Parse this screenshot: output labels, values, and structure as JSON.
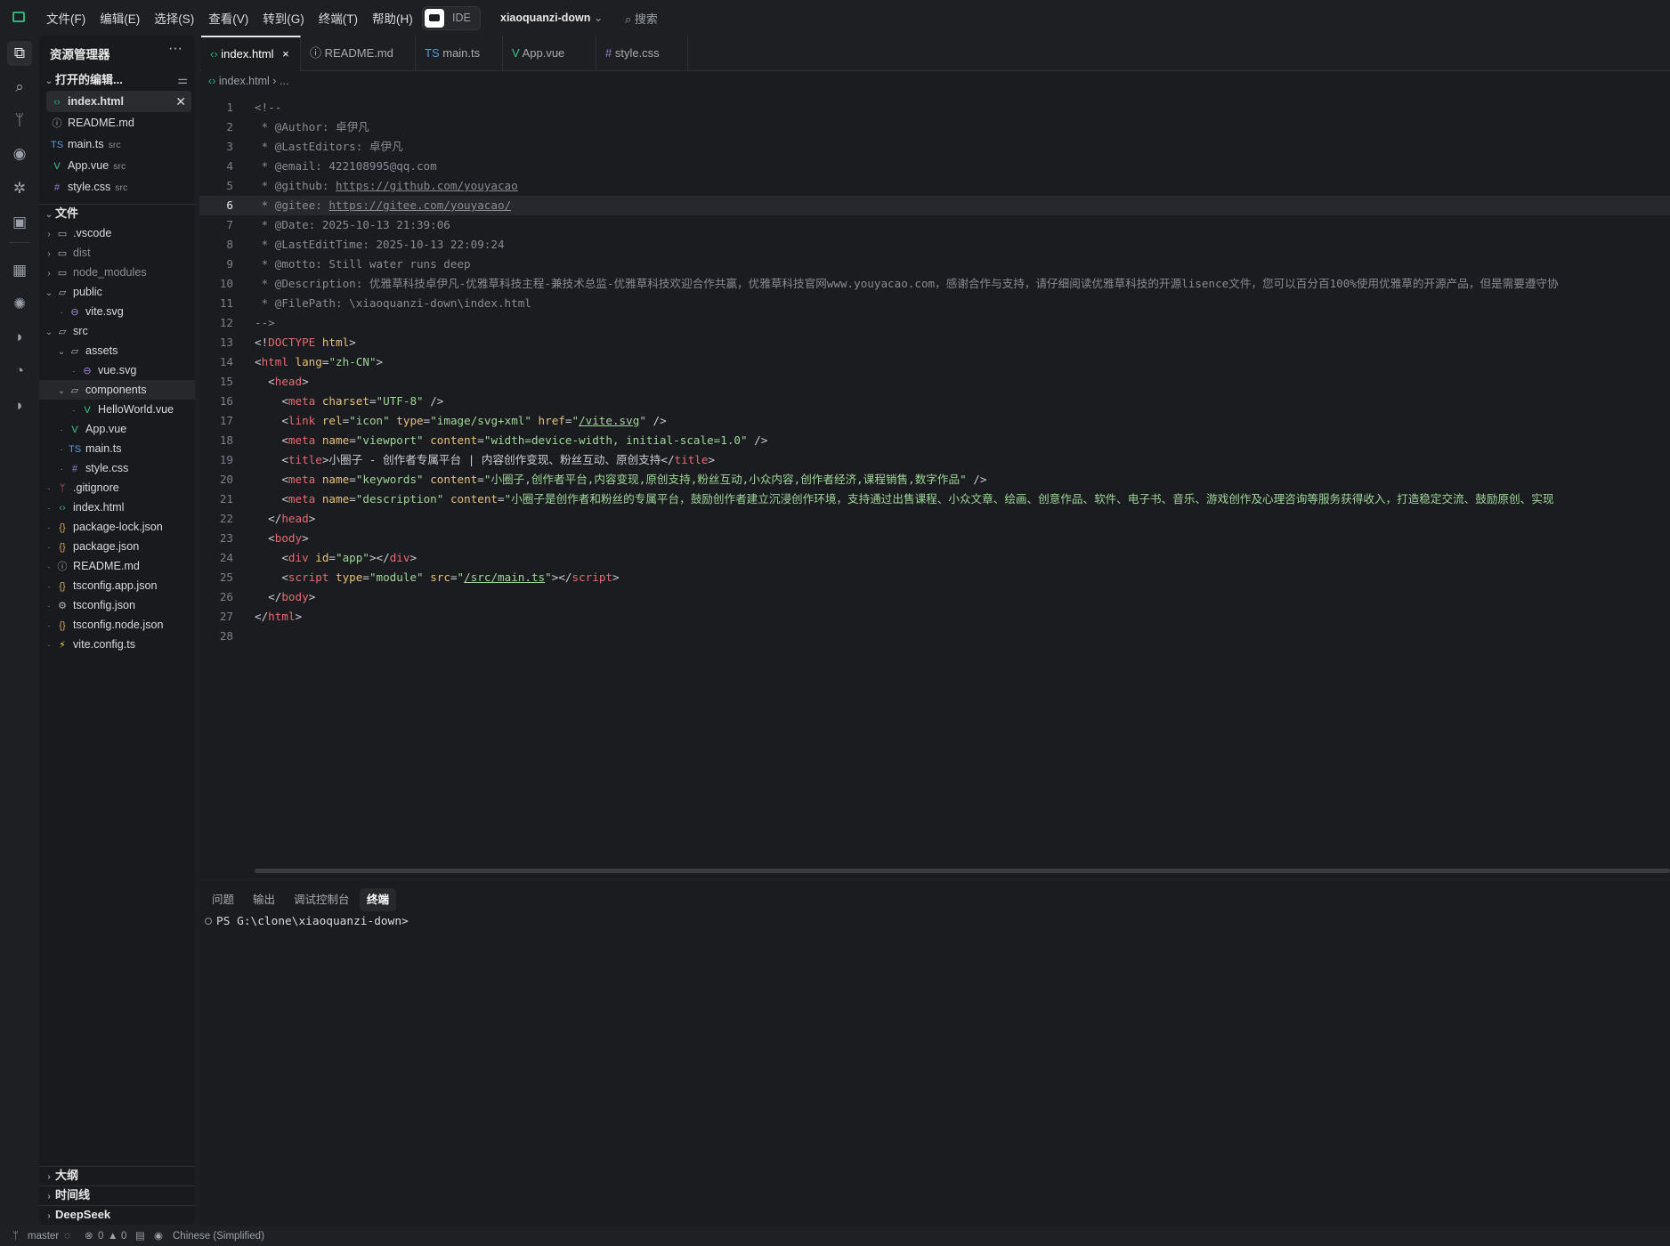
{
  "titlebar": {
    "menus": [
      "文件(F)",
      "编辑(E)",
      "选择(S)",
      "查看(V)",
      "转到(G)",
      "终端(T)",
      "帮助(H)"
    ],
    "ide_label": "IDE",
    "project": "xiaoquanzi-down",
    "search": "搜索"
  },
  "activity": [
    "files-icon",
    "search-icon",
    "source-control-icon",
    "eye-icon",
    "debug-icon",
    "remote-icon",
    "extensions-icon",
    "ai-icon",
    "deepseek-icon",
    "whale-icon",
    "deepseek-alt-icon"
  ],
  "sidebar": {
    "title": "资源管理器",
    "more": "···",
    "open_editors": {
      "label": "打开的编辑...",
      "items": [
        {
          "name": "index.html",
          "icon": "‹›",
          "color": "#2fb37a",
          "dir": "",
          "selected": true
        },
        {
          "name": "README.md",
          "icon": "ⓘ",
          "color": "#b0b4ba",
          "dir": ""
        },
        {
          "name": "main.ts",
          "icon": "TS",
          "color": "#5b9bd5",
          "dir": "src"
        },
        {
          "name": "App.vue",
          "icon": "V",
          "color": "#3ec98a",
          "dir": "src"
        },
        {
          "name": "style.css",
          "icon": "#",
          "color": "#9a7fd6",
          "dir": "src"
        }
      ]
    },
    "files": {
      "label": "文件",
      "items": [
        {
          "name": ".vscode",
          "icon": "▭",
          "color": "#b0b4ba",
          "depth": 0,
          "chev": "›"
        },
        {
          "name": "dist",
          "icon": "▭",
          "color": "#b0b4ba",
          "depth": 0,
          "chev": "›",
          "muted": true
        },
        {
          "name": "node_modules",
          "icon": "▭",
          "color": "#b0b4ba",
          "depth": 0,
          "chev": "›",
          "muted": true
        },
        {
          "name": "public",
          "icon": "▱",
          "color": "#b0b4ba",
          "depth": 0,
          "chev": "⌄"
        },
        {
          "name": "vite.svg",
          "icon": "⊖",
          "color": "#a98ae8",
          "depth": 1
        },
        {
          "name": "src",
          "icon": "▱",
          "color": "#b0b4ba",
          "depth": 0,
          "chev": "⌄"
        },
        {
          "name": "assets",
          "icon": "▱",
          "color": "#b0b4ba",
          "depth": 1,
          "chev": "⌄"
        },
        {
          "name": "vue.svg",
          "icon": "⊖",
          "color": "#a98ae8",
          "depth": 2
        },
        {
          "name": "components",
          "icon": "▱",
          "color": "#b0b4ba",
          "depth": 1,
          "chev": "⌄",
          "hl": true
        },
        {
          "name": "HelloWorld.vue",
          "icon": "V",
          "color": "#3ec98a",
          "depth": 2
        },
        {
          "name": "App.vue",
          "icon": "V",
          "color": "#3ec98a",
          "depth": 1
        },
        {
          "name": "main.ts",
          "icon": "TS",
          "color": "#5b9bd5",
          "depth": 1
        },
        {
          "name": "style.css",
          "icon": "#",
          "color": "#9a7fd6",
          "depth": 1
        },
        {
          "name": ".gitignore",
          "icon": "ᛘ",
          "color": "#e0646a",
          "depth": 0
        },
        {
          "name": "index.html",
          "icon": "‹›",
          "color": "#2fb37a",
          "depth": 0
        },
        {
          "name": "package-lock.json",
          "icon": "{}",
          "color": "#d1a55a",
          "depth": 0
        },
        {
          "name": "package.json",
          "icon": "{}",
          "color": "#d1a55a",
          "depth": 0
        },
        {
          "name": "README.md",
          "icon": "ⓘ",
          "color": "#b0b4ba",
          "depth": 0
        },
        {
          "name": "tsconfig.app.json",
          "icon": "{}",
          "color": "#d1a55a",
          "depth": 0
        },
        {
          "name": "tsconfig.json",
          "icon": "⚙",
          "color": "#b0b4ba",
          "depth": 0
        },
        {
          "name": "tsconfig.node.json",
          "icon": "{}",
          "color": "#d1a55a",
          "depth": 0
        },
        {
          "name": "vite.config.ts",
          "icon": "⚡",
          "color": "#f0d33a",
          "depth": 0
        }
      ]
    },
    "bottom_sections": [
      "大纲",
      "时间线",
      "DeepSeek"
    ]
  },
  "tabs": [
    {
      "label": "index.html",
      "icon": "‹›",
      "color": "#2fb37a",
      "active": true,
      "close": "×"
    },
    {
      "label": "README.md",
      "icon": "ⓘ",
      "color": "#b0b4ba"
    },
    {
      "label": "main.ts",
      "icon": "TS",
      "color": "#5b9bd5"
    },
    {
      "label": "App.vue",
      "icon": "V",
      "color": "#3ec98a"
    },
    {
      "label": "style.css",
      "icon": "#",
      "color": "#9a7fd6"
    }
  ],
  "breadcrumb": {
    "file": "index.html",
    "rest": "..."
  },
  "current_line": 6,
  "code": [
    [
      [
        "<!--",
        "cm"
      ]
    ],
    [
      [
        " * @Author: 卓伊凡",
        "cm"
      ]
    ],
    [
      [
        " * @LastEditors: 卓伊凡",
        "cm"
      ]
    ],
    [
      [
        " * @email: 422108995@qq.com",
        "cm"
      ]
    ],
    [
      [
        " * @github: ",
        "cm"
      ],
      [
        "https://github.com/youyacao",
        "cml"
      ]
    ],
    [
      [
        " * @gitee: ",
        "cm"
      ],
      [
        "https://gitee.com/youyacao/",
        "cml"
      ]
    ],
    [
      [
        " * @Date: 2025-10-13 21:39:06",
        "cm"
      ]
    ],
    [
      [
        " * @LastEditTime: 2025-10-13 22:09:24",
        "cm"
      ]
    ],
    [
      [
        " * @motto: Still water runs deep",
        "cm"
      ]
    ],
    [
      [
        " * @Description: 优雅草科技卓伊凡-优雅草科技主程-兼技术总监-优雅草科技欢迎合作共赢，优雅草科技官网www.youyacao.com，感谢合作与支持，请仔细阅读优雅草科技的开源lisence文件，您可以百分百100%使用优雅草的开源产品，但是需要遵守协",
        "cm"
      ]
    ],
    [
      [
        " * @FilePath: \\xiaoquanzi-down\\index.html",
        "cm"
      ]
    ],
    [
      [
        "-->",
        "cm"
      ]
    ],
    [
      [
        "<!",
        "p"
      ],
      [
        "DOCTYPE",
        "tag"
      ],
      [
        " html",
        "at"
      ],
      [
        ">",
        "p"
      ]
    ],
    [
      [
        "<",
        "p"
      ],
      [
        "html",
        "tag"
      ],
      [
        " lang",
        "at"
      ],
      [
        "=",
        "p"
      ],
      [
        "\"zh-CN\"",
        "st"
      ],
      [
        ">",
        "p"
      ]
    ],
    [
      [
        "  <",
        "p"
      ],
      [
        "head",
        "tag"
      ],
      [
        ">",
        "p"
      ]
    ],
    [
      [
        "    <",
        "p"
      ],
      [
        "meta",
        "tag"
      ],
      [
        " charset",
        "at"
      ],
      [
        "=",
        "p"
      ],
      [
        "\"UTF-8\"",
        "st"
      ],
      [
        " />",
        "p"
      ]
    ],
    [
      [
        "    <",
        "p"
      ],
      [
        "link",
        "tag"
      ],
      [
        " rel",
        "at"
      ],
      [
        "=",
        "p"
      ],
      [
        "\"icon\"",
        "st"
      ],
      [
        " type",
        "at"
      ],
      [
        "=",
        "p"
      ],
      [
        "\"image/svg+xml\"",
        "st"
      ],
      [
        " href",
        "at"
      ],
      [
        "=",
        "p"
      ],
      [
        "\"",
        "st"
      ],
      [
        "/vite.svg",
        "lk"
      ],
      [
        "\"",
        "st"
      ],
      [
        " />",
        "p"
      ]
    ],
    [
      [
        "    <",
        "p"
      ],
      [
        "meta",
        "tag"
      ],
      [
        " name",
        "at"
      ],
      [
        "=",
        "p"
      ],
      [
        "\"viewport\"",
        "st"
      ],
      [
        " content",
        "at"
      ],
      [
        "=",
        "p"
      ],
      [
        "\"width=device-width, initial-scale=1.0\"",
        "st"
      ],
      [
        " />",
        "p"
      ]
    ],
    [
      [
        "    <",
        "p"
      ],
      [
        "title",
        "tag"
      ],
      [
        ">小圈子 - 创作者专属平台 | 内容创作变现、粉丝互动、原创支持",
        "p"
      ],
      [
        "</",
        "p"
      ],
      [
        "title",
        "tag"
      ],
      [
        ">",
        "p"
      ]
    ],
    [
      [
        "    <",
        "p"
      ],
      [
        "meta",
        "tag"
      ],
      [
        " name",
        "at"
      ],
      [
        "=",
        "p"
      ],
      [
        "\"keywords\"",
        "st"
      ],
      [
        " content",
        "at"
      ],
      [
        "=",
        "p"
      ],
      [
        "\"小圈子,创作者平台,内容变现,原创支持,粉丝互动,小众内容,创作者经济,课程销售,数字作品\"",
        "st"
      ],
      [
        " />",
        "p"
      ]
    ],
    [
      [
        "    <",
        "p"
      ],
      [
        "meta",
        "tag"
      ],
      [
        " name",
        "at"
      ],
      [
        "=",
        "p"
      ],
      [
        "\"description\"",
        "st"
      ],
      [
        " content",
        "at"
      ],
      [
        "=",
        "p"
      ],
      [
        "\"小圈子是创作者和粉丝的专属平台，鼓励创作者建立沉浸创作环境，支持通过出售课程、小众文章、绘画、创意作品、软件、电子书、音乐、游戏创作及心理咨询等服务获得收入，打造稳定交流、鼓励原创、实现",
        "st"
      ]
    ],
    [
      [
        "  </",
        "p"
      ],
      [
        "head",
        "tag"
      ],
      [
        ">",
        "p"
      ]
    ],
    [
      [
        "  <",
        "p"
      ],
      [
        "body",
        "tag"
      ],
      [
        ">",
        "p"
      ]
    ],
    [
      [
        "    <",
        "p"
      ],
      [
        "div",
        "tag"
      ],
      [
        " id",
        "at"
      ],
      [
        "=",
        "p"
      ],
      [
        "\"app\"",
        "st"
      ],
      [
        "></",
        "p"
      ],
      [
        "div",
        "tag"
      ],
      [
        ">",
        "p"
      ]
    ],
    [
      [
        "    <",
        "p"
      ],
      [
        "script",
        "tag"
      ],
      [
        " type",
        "at"
      ],
      [
        "=",
        "p"
      ],
      [
        "\"module\"",
        "st"
      ],
      [
        " src",
        "at"
      ],
      [
        "=",
        "p"
      ],
      [
        "\"",
        "st"
      ],
      [
        "/src/main.ts",
        "lk"
      ],
      [
        "\"",
        "st"
      ],
      [
        "></",
        "p"
      ],
      [
        "script",
        "tag"
      ],
      [
        ">",
        "p"
      ]
    ],
    [
      [
        "  </",
        "p"
      ],
      [
        "body",
        "tag"
      ],
      [
        ">",
        "p"
      ]
    ],
    [
      [
        "</",
        "p"
      ],
      [
        "html",
        "tag"
      ],
      [
        ">",
        "p"
      ]
    ],
    []
  ],
  "panel": {
    "tabs": [
      "问题",
      "输出",
      "调试控制台",
      "终端"
    ],
    "active": "终端",
    "terminal_prompt": "PS G:\\clone\\xiaoquanzi-down>"
  },
  "status": {
    "branch": "master",
    "errors": "0",
    "warnings": "0",
    "language": "Chinese (Simplified)"
  }
}
